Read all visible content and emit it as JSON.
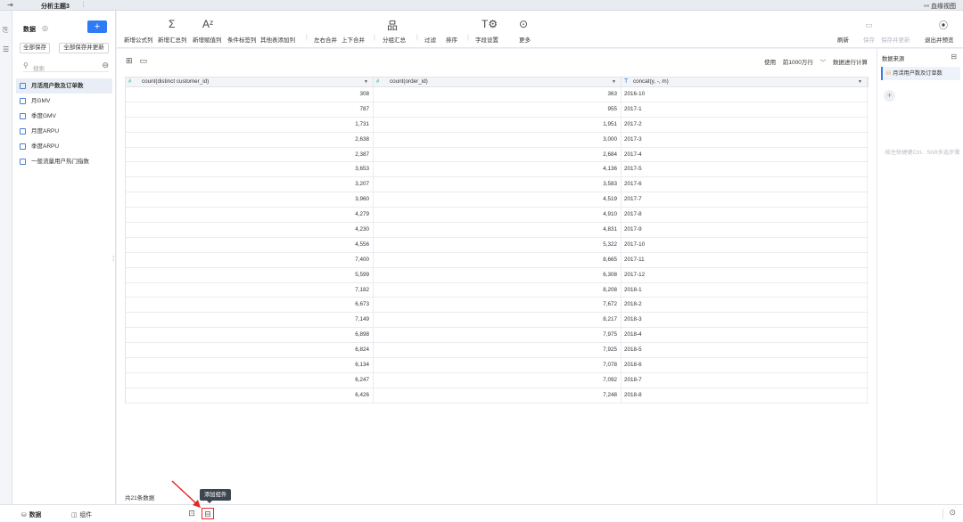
{
  "topbar": {
    "title": "分析主题3",
    "more": "⋮",
    "bloodline": "血缘视图"
  },
  "datapanel": {
    "header": "数据",
    "plus": "+",
    "save_all": "全部保存",
    "save_all_update": "全部保存并更新",
    "search_placeholder": "搜索",
    "tables": [
      "月活用户数及订单数",
      "月GMV",
      "季度GMV",
      "月度ARPU",
      "季度ARPU",
      "一般流量用户热门指数"
    ]
  },
  "toolbar": {
    "formula_col": "新增公式列",
    "summary_col": "新增汇总列",
    "assign_col": "新增赋值列",
    "tag_col": "条件标签列",
    "other_col": "其他表添加列",
    "lr_merge": "左右合并",
    "ud_merge": "上下合并",
    "group_summary": "分组汇总",
    "filter": "过滤",
    "sort": "排序",
    "field_settings": "字段设置",
    "more": "更多",
    "refresh": "刷新",
    "save": "保存",
    "save_update": "保存并更新",
    "exit_preview": "退出并预览"
  },
  "main": {
    "use_label": "使用",
    "row_limit": "前1000万行",
    "compute_label": "数据进行计算",
    "row_count": "共21条数据",
    "columns": [
      {
        "name": "count(distinct customer_id)",
        "type": "#"
      },
      {
        "name": "count(order_id)",
        "type": "#"
      },
      {
        "name": "concat(y, -, m)",
        "type": "T"
      }
    ],
    "rows": [
      [
        "308",
        "363",
        "2016-10"
      ],
      [
        "787",
        "955",
        "2017-1"
      ],
      [
        "1,731",
        "1,951",
        "2017-2"
      ],
      [
        "2,638",
        "3,000",
        "2017-3"
      ],
      [
        "2,387",
        "2,684",
        "2017-4"
      ],
      [
        "3,653",
        "4,136",
        "2017-5"
      ],
      [
        "3,207",
        "3,583",
        "2017-6"
      ],
      [
        "3,960",
        "4,519",
        "2017-7"
      ],
      [
        "4,279",
        "4,910",
        "2017-8"
      ],
      [
        "4,230",
        "4,831",
        "2017-9"
      ],
      [
        "4,556",
        "5,322",
        "2017-10"
      ],
      [
        "7,400",
        "8,665",
        "2017-11"
      ],
      [
        "5,599",
        "6,308",
        "2017-12"
      ],
      [
        "7,182",
        "8,208",
        "2018-1"
      ],
      [
        "6,673",
        "7,672",
        "2018-2"
      ],
      [
        "7,149",
        "8,217",
        "2018-3"
      ],
      [
        "6,898",
        "7,975",
        "2018-4"
      ],
      [
        "6,824",
        "7,925",
        "2018-5"
      ],
      [
        "6,134",
        "7,078",
        "2018-6"
      ],
      [
        "6,247",
        "7,092",
        "2018-7"
      ],
      [
        "6,426",
        "7,248",
        "2018-8"
      ]
    ]
  },
  "rightpanel": {
    "title": "数据来源",
    "source": "月活用户数及订单数",
    "add": "+",
    "hint": "按住快捷键Ctrl、Shift多选步骤"
  },
  "bottombar": {
    "tab_data": "数据",
    "tab_component": "组件",
    "tooltip": "添加组件"
  },
  "colors": {
    "accent": "#2f7bf5",
    "highlight_box": "#e8262a",
    "number_type": "#2fae7c",
    "text_type": "#3a7be0"
  }
}
